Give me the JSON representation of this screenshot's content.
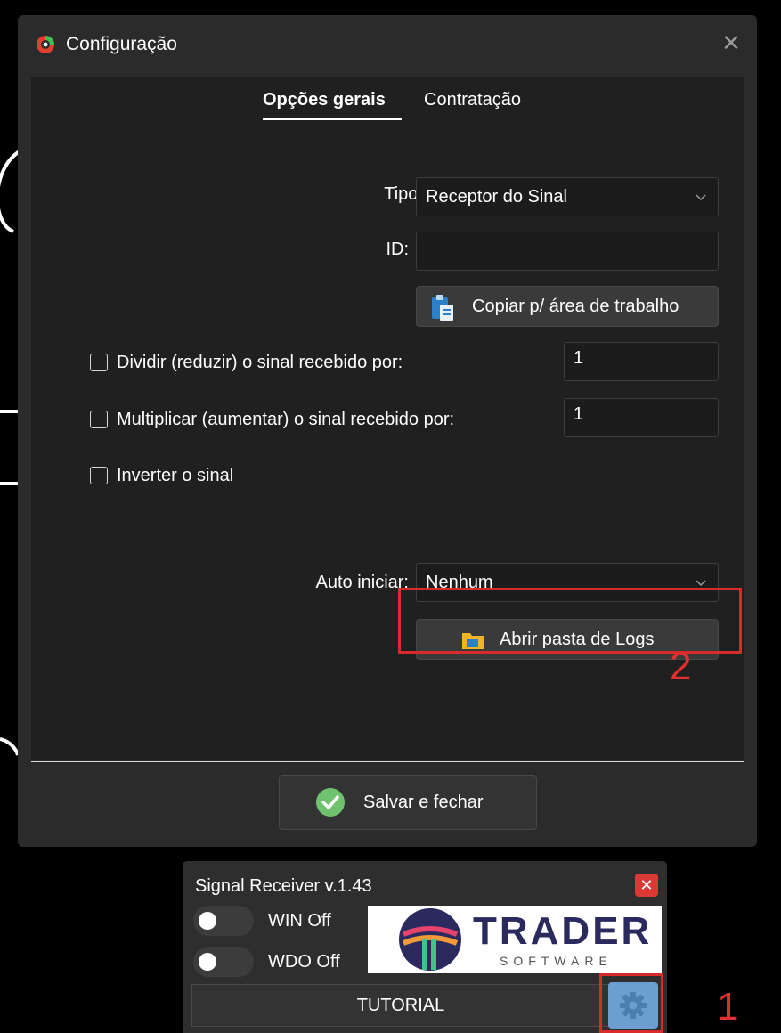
{
  "config_dialog": {
    "title": "Configuração",
    "tabs": [
      {
        "label": "Opções gerais",
        "active": true
      },
      {
        "label": "Contratação",
        "active": false
      }
    ],
    "tipo": {
      "label": "Tipo:",
      "value": "Receptor do Sinal"
    },
    "id": {
      "label": "ID:",
      "value": ""
    },
    "copy_button_label": "Copiar p/ área de trabalho",
    "options": [
      {
        "label": "Dividir (reduzir) o sinal recebido por:",
        "checked": false,
        "value": "1"
      },
      {
        "label": "Multiplicar (aumentar) o sinal recebido por:",
        "checked": false,
        "value": "1"
      },
      {
        "label": "Inverter o sinal",
        "checked": false
      }
    ],
    "auto_iniciar": {
      "label": "Auto iniciar:",
      "value": "Nenhum"
    },
    "open_logs_label": "Abrir pasta de Logs",
    "save_label": "Salvar e fechar"
  },
  "annotations": {
    "one": "1",
    "two": "2",
    "color": "#d82c2c"
  },
  "signal_receiver": {
    "title": "Signal Receiver v.1.43",
    "toggles": [
      {
        "label": "WIN Off",
        "state": "off"
      },
      {
        "label": "WDO Off",
        "state": "off"
      }
    ],
    "logo": {
      "main": "TRADER",
      "sub": "SOFTWARE"
    },
    "tutorial_label": "TUTORIAL"
  },
  "icons": [
    "app-icon",
    "close-icon",
    "chevron-down-icon",
    "clipboard-icon",
    "folder-icon",
    "check-circle-icon",
    "gear-icon"
  ]
}
